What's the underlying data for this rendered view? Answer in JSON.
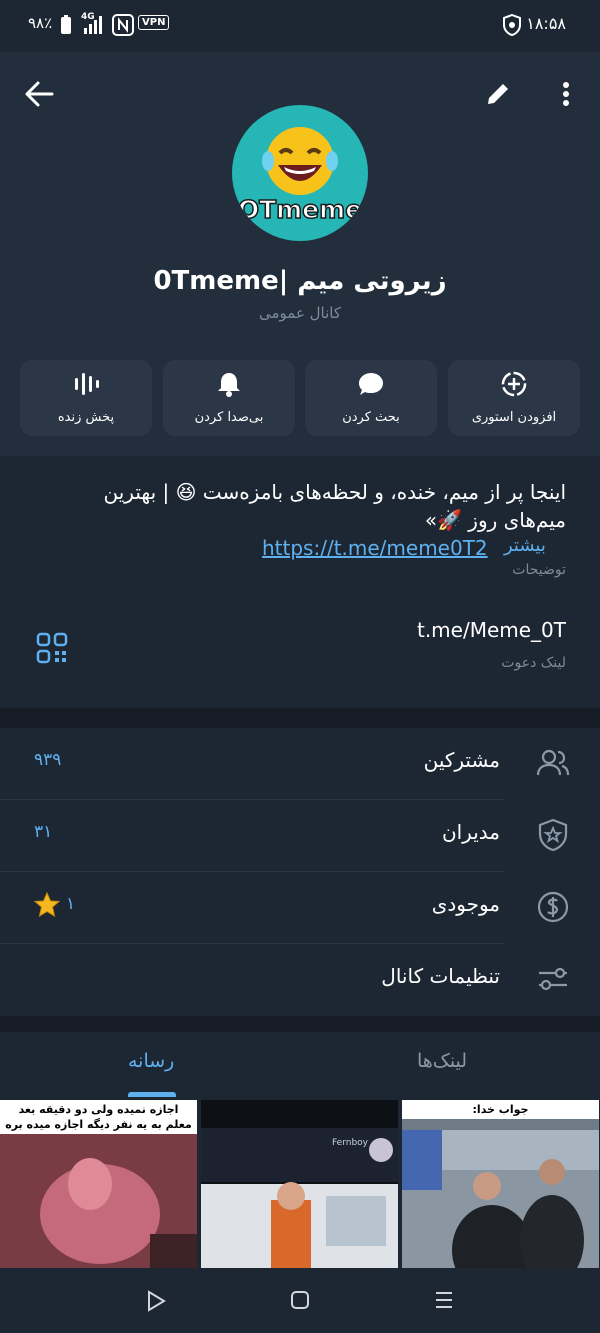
{
  "status_bar": {
    "time": "۱۸:۵۸",
    "battery_percent": "۹۸٪",
    "network": "4G",
    "vpn": "VPN"
  },
  "toolbar": {
    "back_icon": "arrow-left-icon",
    "edit_icon": "pencil-icon",
    "more_icon": "more-vert-icon"
  },
  "channel": {
    "avatar_text": "OTmeme",
    "title": "زیروتی میم |0Tmeme",
    "subtitle": "کانال عمومی"
  },
  "actions": [
    {
      "label": "افزودن استوری",
      "icon": "add-story-icon"
    },
    {
      "label": "بحث کردن",
      "icon": "chat-bubble-icon"
    },
    {
      "label": "بی‌صدا کردن",
      "icon": "bell-icon"
    },
    {
      "label": "پخش زنده",
      "icon": "live-stream-icon"
    }
  ],
  "info": {
    "description": "اینجا پر از میم، خنده، و لحظه‌های بامزه‌ست 😆 | بهترین میم‌های روز 🚀»",
    "link": "https://t.me/meme0T2",
    "more": "بیشتر",
    "description_label": "توضیحات",
    "invite_link": "t.me/Meme_0T",
    "invite_label": "لینک دعوت"
  },
  "stats": [
    {
      "label": "مشترکین",
      "value": "۹۳۹",
      "icon": "people-icon"
    },
    {
      "label": "مدیران",
      "value": "۳۱",
      "icon": "shield-star-icon"
    },
    {
      "label": "موجودی",
      "value": "۱",
      "icon": "dollar-circle-icon"
    },
    {
      "label": "تنظیمات کانال",
      "value": "",
      "icon": "sliders-icon"
    }
  ],
  "tabs": {
    "media": "رسانه",
    "links": "لینک‌ها"
  },
  "media": [
    {
      "caption": "اجازه نمیده ولی دو دقیقه بعد معلم به یه نفر دیگه اجازه میده بره"
    },
    {
      "caption": "Fernboy"
    },
    {
      "caption": "جواب خدا:"
    }
  ],
  "nav": {
    "back": "nav-back-icon",
    "home": "nav-home-icon",
    "recents": "nav-recents-icon"
  },
  "colors": {
    "background": "#1d2733",
    "accent": "#5eb0ef",
    "secondary_text": "#7d8b99"
  }
}
